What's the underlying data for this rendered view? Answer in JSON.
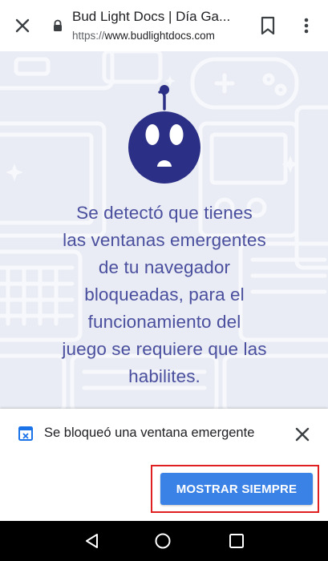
{
  "toolbar": {
    "title": "Bud Light Docs | Día Ga...",
    "url_scheme": "https://",
    "url_host": "www.budlightdocs.com",
    "icons": {
      "close": "close-icon",
      "lock": "lock-icon",
      "bookmark": "bookmark-icon",
      "menu": "more-vert-icon"
    }
  },
  "content": {
    "mascot": "sad-robot-face",
    "message_lines": [
      "Se detectó que tienes",
      "las ventanas emergentes",
      "de tu navegador",
      "bloqueadas, para el",
      "funcionamiento del",
      "juego se requiere que las",
      "habilites."
    ],
    "colors": {
      "background": "#e9ecf4",
      "text": "#4a4f9e",
      "robot": "#2b2f85"
    }
  },
  "infobar": {
    "message": "Se bloqueó una ventana emergente",
    "button_label": "MOSTRAR SIEMPRE",
    "colors": {
      "button": "#3b82e6",
      "highlight": "#e02020"
    }
  },
  "navbar": {
    "icons": [
      "back-icon",
      "home-icon",
      "recents-icon"
    ]
  }
}
